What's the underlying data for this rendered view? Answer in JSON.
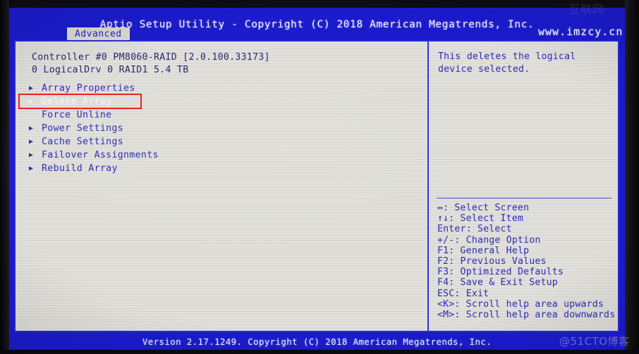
{
  "header": {
    "title": "Aptio Setup Utility - Copyright (C) 2018 American Megatrends, Inc.",
    "tabs": [
      {
        "label": "Advanced",
        "active": true
      }
    ]
  },
  "main": {
    "controller_line": "Controller #0 PM8060-RAID [2.0.100.33173]",
    "logical_drive_line": "0 LogicalDrv 0 RAID1 5.4 TB",
    "menu_items": [
      {
        "label": "Array Properties",
        "bullet": "submenu-arrow",
        "selected": false
      },
      {
        "label": "Delete Array",
        "bullet": "submenu-arrow",
        "selected": true
      },
      {
        "label": "Force Unline",
        "bullet": "none",
        "selected": false
      },
      {
        "label": "Power Settings",
        "bullet": "submenu-arrow",
        "selected": false
      },
      {
        "label": "Cache Settings",
        "bullet": "submenu-arrow",
        "selected": false
      },
      {
        "label": "Failover Assignments",
        "bullet": "submenu-arrow",
        "selected": false
      },
      {
        "label": "Rebuild Array",
        "bullet": "submenu-arrow",
        "selected": false
      }
    ]
  },
  "help": {
    "description": "This deletes the logical device selected.",
    "keys": [
      {
        "key": "↔",
        "action": ": Select Screen"
      },
      {
        "key": "↑↓",
        "action": ": Select Item"
      },
      {
        "key": "Enter",
        "action": ": Select"
      },
      {
        "key": "+/-",
        "action": ": Change Option"
      },
      {
        "key": "F1",
        "action": ": General Help"
      },
      {
        "key": "F2",
        "action": ": Previous Values"
      },
      {
        "key": "F3",
        "action": ": Optimized Defaults"
      },
      {
        "key": "F4",
        "action": ": Save & Exit Setup"
      },
      {
        "key": "ESC",
        "action": ": Exit"
      },
      {
        "key": "<K>",
        "action": ": Scroll help area upwards"
      },
      {
        "key": "<M>",
        "action": ": Scroll help area downwards"
      }
    ]
  },
  "footer": {
    "version_text": "Version 2.17.1249. Copyright (C) 2018 American Megatrends, Inc."
  },
  "watermarks": {
    "url": "www.imzcy.cn",
    "top_right": "互联网",
    "bottom_right": "@51CTO博客"
  },
  "annotation": {
    "type": "red-rectangle",
    "targets": "Delete Array",
    "color": "#ee1d1d"
  },
  "colors": {
    "band_blue": "#1b1bcd",
    "panel_bg": "#e2e1dc",
    "text_blue": "#2a2ab4",
    "selected_text": "#f4f4f4",
    "annotation_red": "#ee1d1d"
  }
}
